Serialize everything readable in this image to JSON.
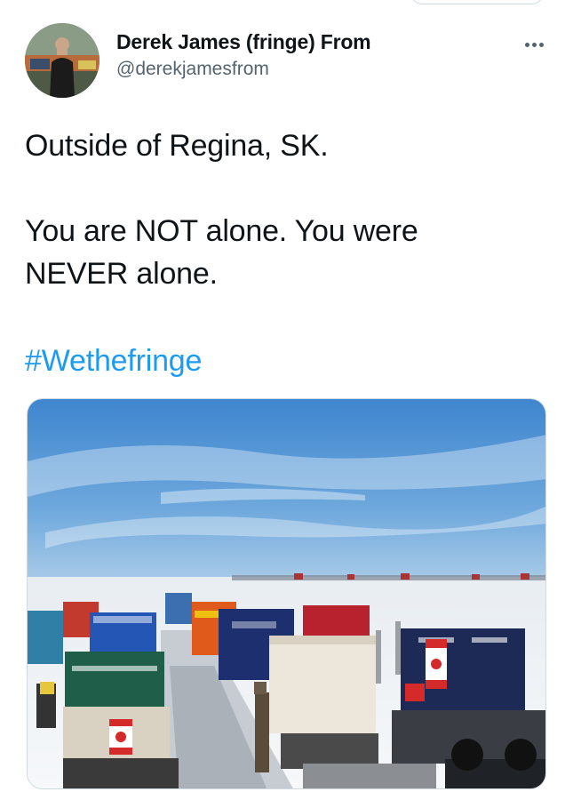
{
  "tweet": {
    "author": {
      "display_name": "Derek James (fringe) From",
      "handle": "@derekjamesfrom",
      "avatar_icon": "user-avatar-photo"
    },
    "more_icon": "more-horizontal-icon",
    "text_lines": [
      "Outside of Regina, SK.",
      "You are NOT alone. You were",
      "NEVER alone."
    ],
    "hashtag": "#Wethefringe",
    "media": {
      "icon": "photo-trucks-convoy"
    }
  },
  "colors": {
    "text": "#0f1419",
    "secondary": "#536471",
    "link": "#1d9bf0",
    "border": "#cfd9de"
  }
}
